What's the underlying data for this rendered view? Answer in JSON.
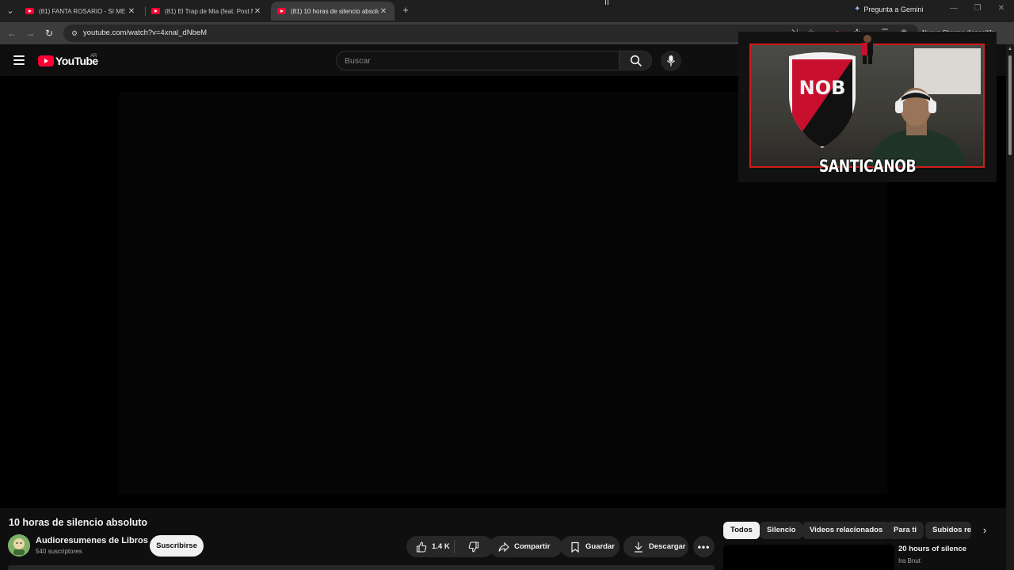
{
  "browser": {
    "tabs": [
      {
        "title": "(81) FANTA ROSARIO - SI ME H",
        "active": false
      },
      {
        "title": "(81) El Trap de Mia (feat. Post M",
        "active": false
      },
      {
        "title": "(81) 10 horas de silencio absolu",
        "active": true
      }
    ],
    "gemini_label": "Pregunta a Gemini",
    "url": "youtube.com/watch?v=4xnal_dNbeM",
    "update_chip": "Nuevo Chrome disponible"
  },
  "youtube": {
    "logo_text": "YouTube",
    "region": "AR",
    "search_placeholder": "Buscar"
  },
  "overlay": {
    "shield_text": "NOB",
    "streamer_name": "SANTICANOB"
  },
  "video": {
    "title": "10 horas de silencio absoluto",
    "channel_name": "Audioresumenes de Libros",
    "subscribers": "540 suscriptores",
    "subscribe_label": "Suscribirse",
    "likes": "1.4 K",
    "share_label": "Compartir",
    "save_label": "Guardar",
    "download_label": "Descargar"
  },
  "sidebar": {
    "chips": [
      "Todos",
      "Silencio",
      "Videos relacionados",
      "Para ti",
      "Subidos re"
    ],
    "active_chip": "Todos",
    "recommendation": {
      "title": "20 hours of silence",
      "channel": "Ira Bnut"
    }
  },
  "colors": {
    "yt_red": "#ff0033",
    "background": "#0f0f0f",
    "overlay_border": "#d01c1c",
    "nob_red": "#c8102e"
  }
}
